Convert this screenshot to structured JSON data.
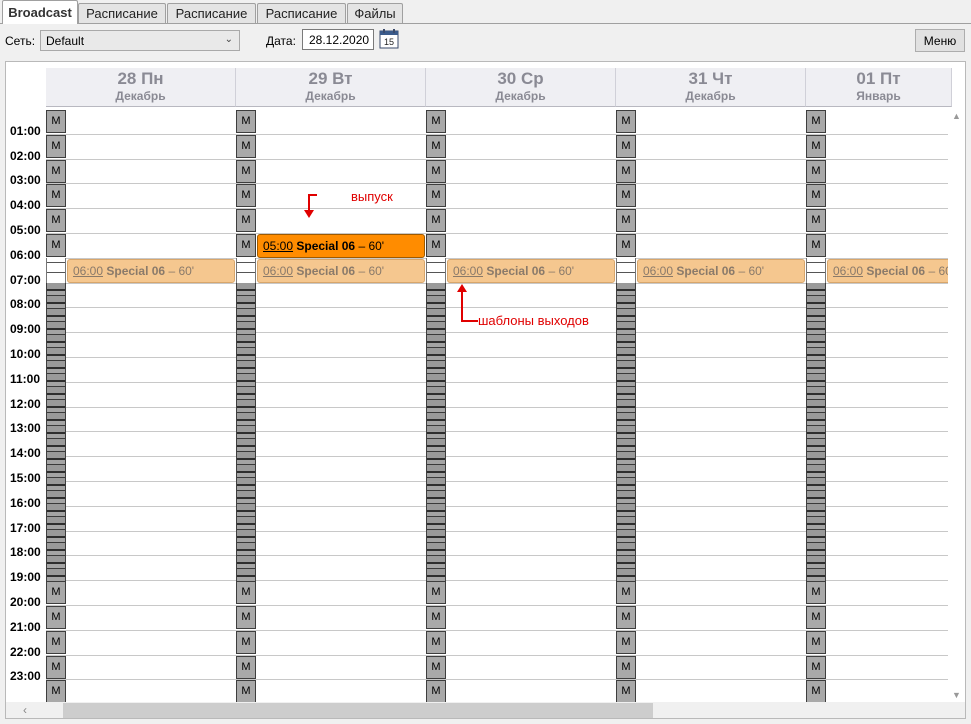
{
  "tabs": [
    {
      "label": "Broadcast",
      "active": true
    },
    {
      "label": "Расписание"
    },
    {
      "label": "Расписание"
    },
    {
      "label": "Расписание"
    },
    {
      "label": "Файлы"
    }
  ],
  "toolbar": {
    "network_label": "Сеть:",
    "network_value": "Default",
    "date_label": "Дата:",
    "date_value": "28.12.2020",
    "calendar_icon_day": "15",
    "menu_label": "Меню"
  },
  "days": [
    {
      "title": "28 Пн",
      "month": "Декабрь"
    },
    {
      "title": "29 Вт",
      "month": "Декабрь"
    },
    {
      "title": "30 Ср",
      "month": "Декабрь"
    },
    {
      "title": "31 Чт",
      "month": "Декабрь"
    },
    {
      "title": "01 Пт",
      "month": "Январь"
    }
  ],
  "hours": [
    "01:00",
    "02:00",
    "03:00",
    "04:00",
    "05:00",
    "06:00",
    "07:00",
    "08:00",
    "09:00",
    "10:00",
    "11:00",
    "12:00",
    "13:00",
    "14:00",
    "15:00",
    "16:00",
    "17:00",
    "18:00",
    "19:00",
    "20:00",
    "21:00",
    "22:00",
    "23:00"
  ],
  "marker_letter": "M",
  "templates": {
    "time": "06:00",
    "name": "Special 06",
    "duration": "– 60'"
  },
  "live_event": {
    "time": "05:00",
    "name": "Special 06",
    "duration": "– 60'"
  },
  "annotations": {
    "release": "выпуск",
    "templates": "шаблоны выходов"
  },
  "colors": {
    "template_fill": "#f5c78f",
    "live_fill": "#ff8c00",
    "annotation": "#e00000"
  }
}
